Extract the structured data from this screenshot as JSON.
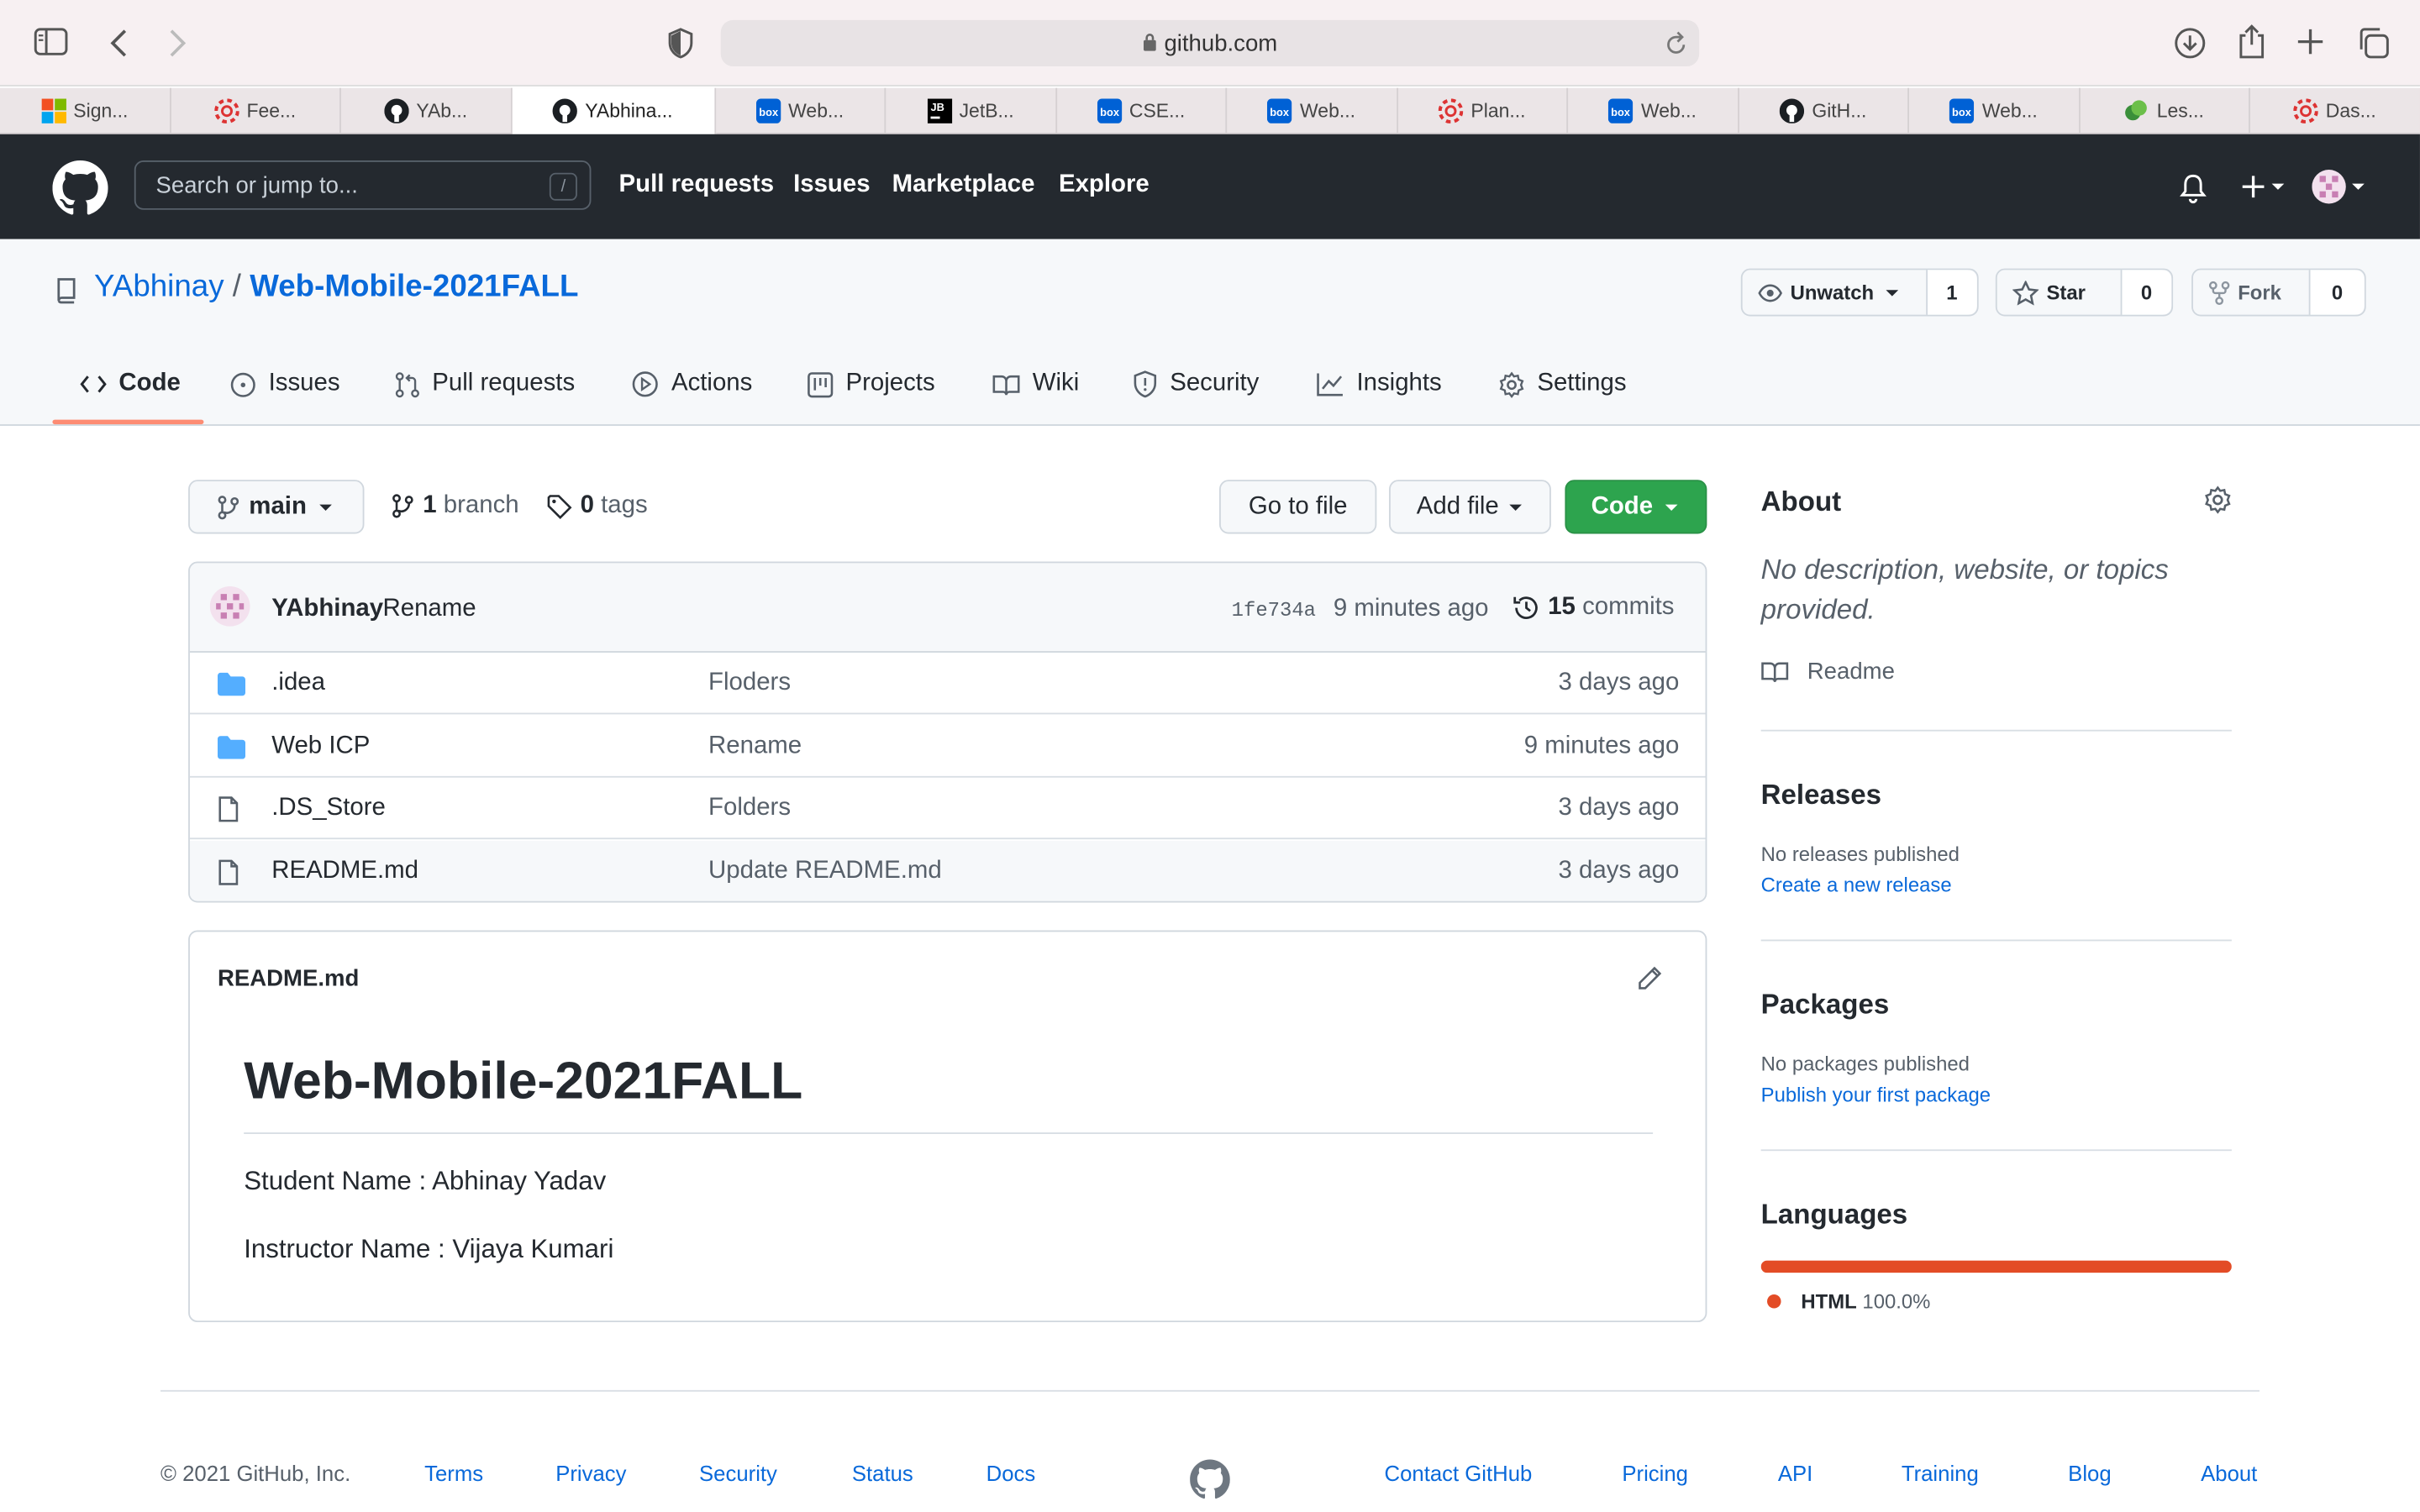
{
  "browser": {
    "url": "github.com",
    "tabs": [
      {
        "label": "Sign...",
        "icon": "microsoft-icon"
      },
      {
        "label": "Fee...",
        "icon": "lifebuoy-icon"
      },
      {
        "label": "YAb...",
        "icon": "github-icon"
      },
      {
        "label": "YAbhina...",
        "icon": "github-icon",
        "active": true
      },
      {
        "label": "Web...",
        "icon": "box-icon"
      },
      {
        "label": "JetB...",
        "icon": "jetbrains-icon"
      },
      {
        "label": "CSE...",
        "icon": "box-icon"
      },
      {
        "label": "Web...",
        "icon": "box-icon"
      },
      {
        "label": "Plan...",
        "icon": "lifebuoy-icon"
      },
      {
        "label": "Web...",
        "icon": "box-icon"
      },
      {
        "label": "GitH...",
        "icon": "github-icon"
      },
      {
        "label": "Web...",
        "icon": "box-icon"
      },
      {
        "label": "Les...",
        "icon": "leaf-icon"
      },
      {
        "label": "Das...",
        "icon": "lifebuoy-icon"
      }
    ]
  },
  "header": {
    "search_placeholder": "Search or jump to...",
    "slash": "/",
    "nav": [
      "Pull requests",
      "Issues",
      "Marketplace",
      "Explore"
    ]
  },
  "repo": {
    "owner": "YAbhinay",
    "sep": "/",
    "name": "Web-Mobile-2021FALL",
    "watch_label": "Unwatch",
    "watch_count": "1",
    "star_label": "Star",
    "star_count": "0",
    "fork_label": "Fork",
    "fork_count": "0",
    "tabs": [
      "Code",
      "Issues",
      "Pull requests",
      "Actions",
      "Projects",
      "Wiki",
      "Security",
      "Insights",
      "Settings"
    ]
  },
  "toolbar": {
    "branch": "main",
    "branch_count": "1",
    "branch_word": "branch",
    "tag_count": "0",
    "tag_word": "tags",
    "goto_file": "Go to file",
    "add_file": "Add file",
    "code": "Code"
  },
  "commit": {
    "author": "YAbhinay",
    "message": "Rename",
    "sha": "1fe734a",
    "age": "9 minutes ago",
    "count": "15",
    "count_word": "commits"
  },
  "files": [
    {
      "type": "folder",
      "name": ".idea",
      "message": "Floders",
      "age": "3 days ago"
    },
    {
      "type": "folder",
      "name": "Web ICP",
      "message": "Rename",
      "age": "9 minutes ago"
    },
    {
      "type": "file",
      "name": ".DS_Store",
      "message": "Folders",
      "age": "3 days ago"
    },
    {
      "type": "file",
      "name": "README.md",
      "message": "Update README.md",
      "age": "3 days ago"
    }
  ],
  "readme": {
    "filename": "README.md",
    "heading": "Web-Mobile-2021FALL",
    "lines": [
      "Student Name : Abhinay Yadav",
      "Instructor Name : Vijaya Kumari"
    ]
  },
  "sidebar": {
    "about_title": "About",
    "about_text": "No description, website, or topics provided.",
    "readme_link": "Readme",
    "releases_title": "Releases",
    "releases_text": "No releases published",
    "releases_link": "Create a new release",
    "packages_title": "Packages",
    "packages_text": "No packages published",
    "packages_link": "Publish your first package",
    "languages_title": "Languages",
    "language_name": "HTML",
    "language_percent": "100.0%",
    "language_share": 1.0,
    "language_color": "#e34c26"
  },
  "footer": {
    "copyright": "© 2021 GitHub, Inc.",
    "left_links": [
      "Terms",
      "Privacy",
      "Security",
      "Status",
      "Docs"
    ],
    "right_links": [
      "Contact GitHub",
      "Pricing",
      "API",
      "Training",
      "Blog",
      "About"
    ]
  }
}
